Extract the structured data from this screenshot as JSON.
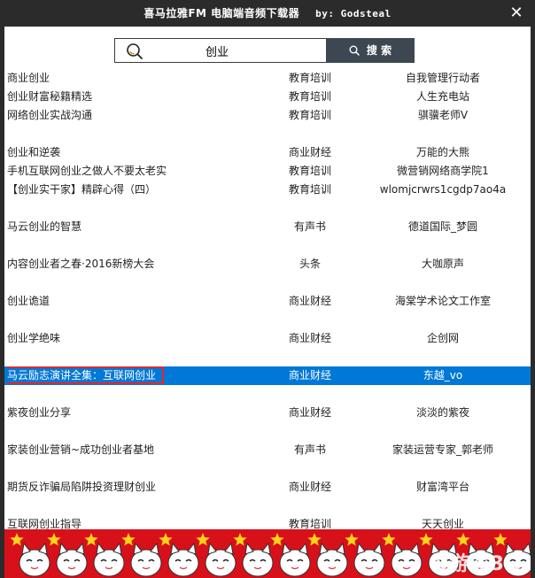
{
  "window": {
    "title": "喜马拉雅FM 电脑端音频下载器",
    "by": "by: Godsteal",
    "close_glyph": "✕"
  },
  "search": {
    "value": "创业",
    "button_label": "搜 索"
  },
  "rows": [
    {
      "name": "商业创业",
      "category": "教育培训",
      "author": "自我管理行动者"
    },
    {
      "name": "创业财富秘籍精选",
      "category": "教育培训",
      "author": "人生充电站"
    },
    {
      "name": "网络创业实战沟通",
      "category": "教育培训",
      "author": "骐骥老师V"
    },
    {
      "name": "创业和逆袭",
      "category": "商业财经",
      "author": "万能的大熊"
    },
    {
      "name": "手机互联网创业之做人不要太老实",
      "category": "教育培训",
      "author": "微营销网络商学院1"
    },
    {
      "name": "【创业实干家】精辟心得（四）",
      "category": "教育培训",
      "author": "wlomjcrwrs1cgdp7ao4a"
    },
    {
      "name": "马云创业的智慧",
      "category": "有声书",
      "author": "德道国际_梦圆"
    },
    {
      "name": "内容创业者之春·2016新榜大会",
      "category": "头条",
      "author": "大咖原声"
    },
    {
      "name": "创业诡道",
      "category": "商业财经",
      "author": "海棠学术论文工作室"
    },
    {
      "name": "创业学绝味",
      "category": "商业财经",
      "author": "企创网"
    },
    {
      "name": "马云励志演讲全集：互联网创业",
      "category": "商业财经",
      "author": "东越_vo"
    },
    {
      "name": "紫夜创业分享",
      "category": "商业财经",
      "author": "淡淡的紫夜"
    },
    {
      "name": "家装创业营销~成功创业者基地",
      "category": "有声书",
      "author": "家装运营专家_郭老师"
    },
    {
      "name": "期货反诈骗局陷阱投资理财创业",
      "category": "商业财经",
      "author": "财富湾平台"
    },
    {
      "name": "互联网创业指导",
      "category": "教育培训",
      "author": "天天创业"
    }
  ],
  "selected_index": 10,
  "banner": {
    "watermark": "9游戏3G"
  },
  "colors": {
    "titlebar": "#2b2b2b",
    "selection": "#0078d7",
    "highlight_box": "#e0282b",
    "search_button": "#3d4751",
    "banner": "#d8101a"
  }
}
